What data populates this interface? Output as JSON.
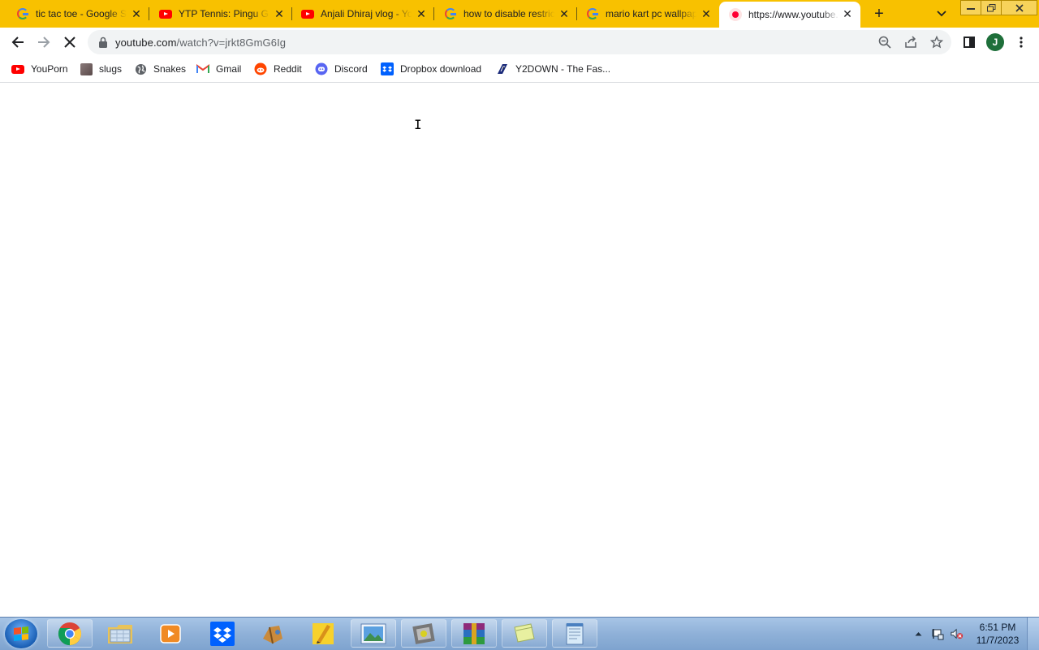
{
  "tabs": [
    {
      "title": "tic tac toe - Google Search",
      "icon": "google-icon",
      "active": false
    },
    {
      "title": "YTP Tennis: Pingu Goes",
      "icon": "youtube-icon",
      "active": false
    },
    {
      "title": "Anjali Dhiraj vlog - YouTube",
      "icon": "youtube-icon",
      "active": false
    },
    {
      "title": "how to disable restrictions",
      "icon": "google-icon",
      "active": false
    },
    {
      "title": "mario kart pc wallpaper",
      "icon": "google-icon",
      "active": false
    },
    {
      "title": "https://www.youtube.com",
      "icon": "youtube-loading-icon",
      "active": true
    }
  ],
  "toolbar": {
    "url_host": "youtube.com",
    "url_path": "/watch?v=jrkt8GmG6Ig",
    "profile_initial": "J"
  },
  "bookmarks": [
    {
      "label": "YouPorn",
      "icon": "youtube-icon"
    },
    {
      "label": "slugs",
      "icon": "image-icon"
    },
    {
      "label": "Snakes",
      "icon": "globe-icon"
    },
    {
      "label": "Gmail",
      "icon": "gmail-icon"
    },
    {
      "label": "Reddit",
      "icon": "reddit-icon"
    },
    {
      "label": "Discord",
      "icon": "discord-icon"
    },
    {
      "label": "Dropbox download",
      "icon": "dropbox-icon"
    },
    {
      "label": "Y2DOWN - The Fas...",
      "icon": "y2down-icon"
    }
  ],
  "taskbar": {
    "items": [
      "chrome-icon",
      "file-explorer-icon",
      "media-player-icon",
      "dropbox-icon",
      "audio-app-icon",
      "sticky-pen-icon",
      "photo-viewer-icon",
      "game-icon",
      "winrar-icon",
      "notes-icon",
      "notepad-icon"
    ],
    "clock_time": "6:51 PM",
    "clock_date": "11/7/2023"
  },
  "colors": {
    "tab_strip": "#f8c100",
    "taskbar": "#8fb1d8"
  }
}
